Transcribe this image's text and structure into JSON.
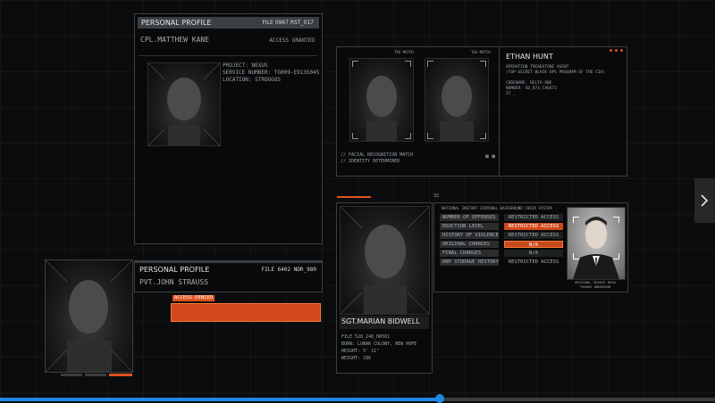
{
  "profile_matthew": {
    "header_title": "PERSONAL PROFILE",
    "file_no": "FILE 0967 RST_017",
    "name": "CPL.MATTHEW KANE",
    "access": "ACCESS GRANTED",
    "details": [
      "PROJECT: NEXUS",
      "SERVICE NUMBER: TG009-E9135045",
      "LOCATION: STROGGOS"
    ]
  },
  "face_match": {
    "tag_left": "TAG MATCH",
    "tag_right": "TAG MATCH",
    "captions": [
      "// FACIAL RECOGNITION MATCH",
      "// IDENTITY DETERMINED"
    ]
  },
  "ethan_hunt": {
    "name": "ETHAN HUNT",
    "lines": [
      "OPERATION TREADSTONE AGENT",
      "(TOP-SECRET BLACK OPS PROGRAM OF THE CIA)",
      "",
      "CODENAME: DELTA-ONE",
      "NUMBER: SD_874_CA6673",
      "ST _"
    ]
  },
  "profile_john": {
    "header_title": "PERSONAL PROFILE",
    "file_no": "FILE 6402 NDR_980",
    "name": "PVT.JOHN STRAUSS",
    "access_denied": "ACCESS DENIED"
  },
  "background_check": {
    "title": "NATIONAL INSTANT CRIMINAL BACKGROUND CHECK SYSTEM",
    "marker": "32",
    "rows": [
      {
        "label": "NUMBER OF OFFENSES",
        "value": "RESTRICTED ACCESS",
        "status": "normal"
      },
      {
        "label": "EDUCTION LEVEL",
        "value": "RESTRICTED ACCESS",
        "status": "alert"
      },
      {
        "label": "HISTORY OF VIOLENCE",
        "value": "RESTRICTED ACCESS",
        "status": "normal"
      },
      {
        "label": "ORIGINAL CHARGES",
        "value": "N/A",
        "status": "alert2"
      },
      {
        "label": "FINAL CHARGES",
        "value": "N/A",
        "status": "normal"
      },
      {
        "label": "DNP STORAGE HISTORY",
        "value": "RESTRICTED ACCESS",
        "status": "plain"
      }
    ],
    "suspect_caption": [
      "ORIGINAL SEARCH HEAD",
      "THOMAS ANDERSON"
    ]
  },
  "profile_marian": {
    "name": "SGT.MARIAN BIDWELL",
    "details": [
      "FILE 528_246_HR581",
      "BORN: LUNAR COLONY, NEW HOPE",
      "HEIGHT: 5' 11\"",
      "WEIGHT: 186"
    ]
  },
  "colors": {
    "accent": "#e0531f",
    "panel_border": "#3c3f42",
    "progress_bar": "#1e88e5"
  },
  "icons": [
    "chevron-right-icon"
  ],
  "video_progress": 0.615
}
